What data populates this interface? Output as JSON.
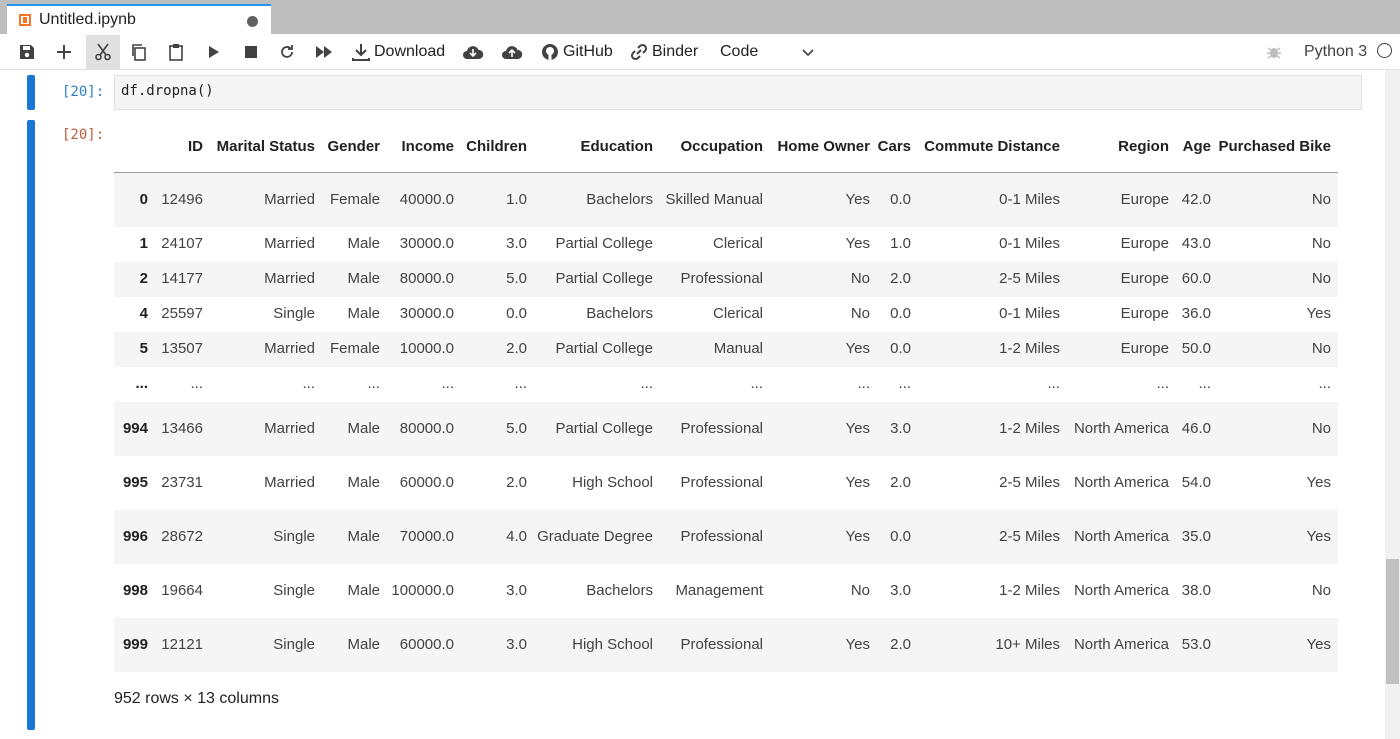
{
  "tab": {
    "title": "Untitled.ipynb",
    "icon": "notebook-icon"
  },
  "toolbar": {
    "download_label": "Download",
    "github_label": "GitHub",
    "binder_label": "Binder",
    "cell_type": "Code",
    "kernel_name": "Python 3"
  },
  "cell_in": {
    "prompt": "[20]:",
    "code": "df.dropna()"
  },
  "cell_out": {
    "prompt": "[20]:",
    "columns": [
      "ID",
      "Marital Status",
      "Gender",
      "Income",
      "Children",
      "Education",
      "Occupation",
      "Home Owner",
      "Cars",
      "Commute Distance",
      "Region",
      "Age",
      "Purchased Bike"
    ],
    "rows": [
      {
        "index": "0",
        "cells": [
          "12496",
          "Married",
          "Female",
          "40000.0",
          "1.0",
          "Bachelors",
          "Skilled Manual",
          "Yes",
          "0.0",
          "0-1 Miles",
          "Europe",
          "42.0",
          "No"
        ]
      },
      {
        "index": "1",
        "cells": [
          "24107",
          "Married",
          "Male",
          "30000.0",
          "3.0",
          "Partial College",
          "Clerical",
          "Yes",
          "1.0",
          "0-1 Miles",
          "Europe",
          "43.0",
          "No"
        ]
      },
      {
        "index": "2",
        "cells": [
          "14177",
          "Married",
          "Male",
          "80000.0",
          "5.0",
          "Partial College",
          "Professional",
          "No",
          "2.0",
          "2-5 Miles",
          "Europe",
          "60.0",
          "No"
        ]
      },
      {
        "index": "4",
        "cells": [
          "25597",
          "Single",
          "Male",
          "30000.0",
          "0.0",
          "Bachelors",
          "Clerical",
          "No",
          "0.0",
          "0-1 Miles",
          "Europe",
          "36.0",
          "Yes"
        ]
      },
      {
        "index": "5",
        "cells": [
          "13507",
          "Married",
          "Female",
          "10000.0",
          "2.0",
          "Partial College",
          "Manual",
          "Yes",
          "0.0",
          "1-2 Miles",
          "Europe",
          "50.0",
          "No"
        ]
      },
      {
        "index": "...",
        "cells": [
          "...",
          "...",
          "...",
          "...",
          "...",
          "...",
          "...",
          "...",
          "...",
          "...",
          "...",
          "...",
          "..."
        ]
      },
      {
        "index": "994",
        "cells": [
          "13466",
          "Married",
          "Male",
          "80000.0",
          "5.0",
          "Partial College",
          "Professional",
          "Yes",
          "3.0",
          "1-2 Miles",
          "North America",
          "46.0",
          "No"
        ]
      },
      {
        "index": "995",
        "cells": [
          "23731",
          "Married",
          "Male",
          "60000.0",
          "2.0",
          "High School",
          "Professional",
          "Yes",
          "2.0",
          "2-5 Miles",
          "North America",
          "54.0",
          "Yes"
        ]
      },
      {
        "index": "996",
        "cells": [
          "28672",
          "Single",
          "Male",
          "70000.0",
          "4.0",
          "Graduate Degree",
          "Professional",
          "Yes",
          "0.0",
          "2-5 Miles",
          "North America",
          "35.0",
          "Yes"
        ]
      },
      {
        "index": "998",
        "cells": [
          "19664",
          "Single",
          "Male",
          "100000.0",
          "3.0",
          "Bachelors",
          "Management",
          "No",
          "3.0",
          "1-2 Miles",
          "North America",
          "38.0",
          "No"
        ]
      },
      {
        "index": "999",
        "cells": [
          "12121",
          "Single",
          "Male",
          "60000.0",
          "3.0",
          "High School",
          "Professional",
          "Yes",
          "2.0",
          "10+ Miles",
          "North America",
          "53.0",
          "Yes"
        ]
      }
    ],
    "summary": "952 rows × 13 columns"
  }
}
